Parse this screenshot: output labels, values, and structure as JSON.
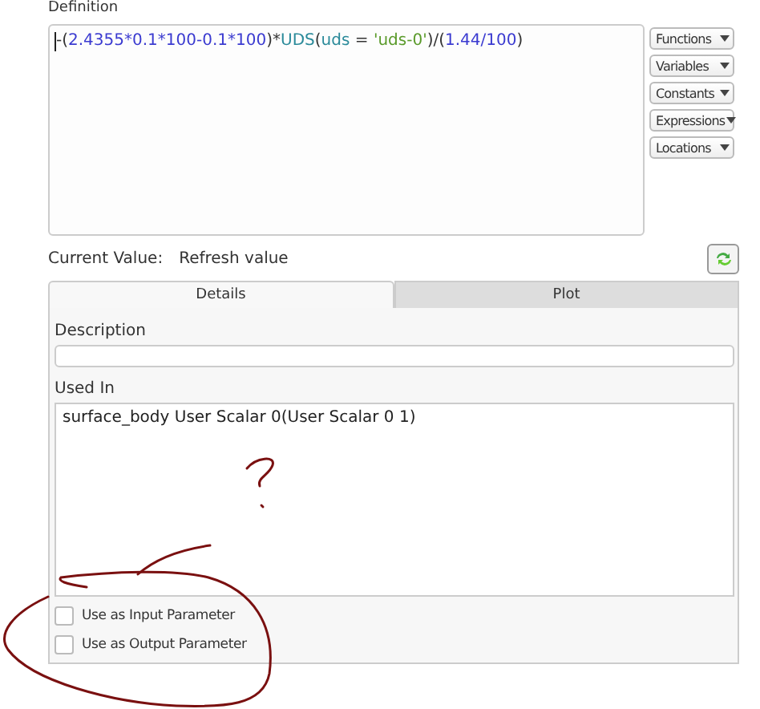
{
  "definition": {
    "label": "Definition",
    "tokens": [
      {
        "text": "-(",
        "kind": "op"
      },
      {
        "text": "2.4355*0.1*100-0.1*100",
        "kind": "num"
      },
      {
        "text": ")*",
        "kind": "op"
      },
      {
        "text": "UDS",
        "kind": "func"
      },
      {
        "text": "(",
        "kind": "op"
      },
      {
        "text": "uds",
        "kind": "func"
      },
      {
        "text": " = ",
        "kind": "op"
      },
      {
        "text": "'uds-0'",
        "kind": "str"
      },
      {
        "text": ")/(",
        "kind": "op"
      },
      {
        "text": "1.44/100",
        "kind": "num"
      },
      {
        "text": ")",
        "kind": "op"
      }
    ]
  },
  "insert_buttons": [
    "Functions",
    "Variables",
    "Constants",
    "Expressions",
    "Locations"
  ],
  "current_value": {
    "label": "Current Value:",
    "value": "Refresh value"
  },
  "tabs": [
    {
      "label": "Details",
      "selected": true
    },
    {
      "label": "Plot",
      "selected": false
    }
  ],
  "description": {
    "label": "Description"
  },
  "used_in": {
    "label": "Used In",
    "text": "surface_body User Scalar 0(User Scalar 0  1)"
  },
  "options": [
    {
      "label": "Use as Input Parameter",
      "checked": false
    },
    {
      "label": "Use as Output Parameter",
      "checked": false
    }
  ]
}
